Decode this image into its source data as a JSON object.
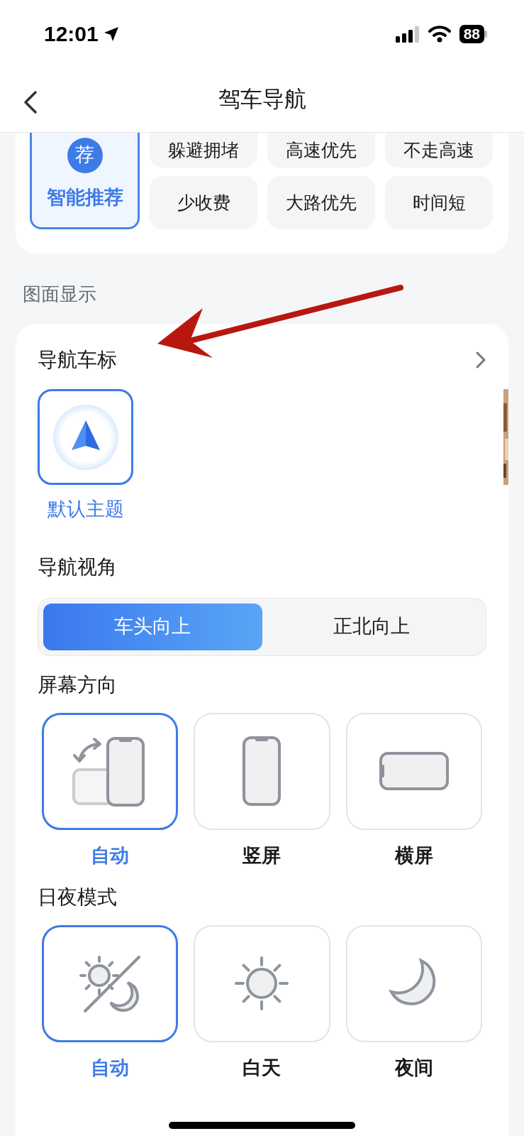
{
  "status_bar": {
    "time": "12:01",
    "battery": "88"
  },
  "header": {
    "title": "驾车导航"
  },
  "route_preferences": {
    "featured": {
      "badge": "荐",
      "label": "智能推荐",
      "selected": true
    },
    "options": [
      {
        "label": "躲避拥堵",
        "selected": false
      },
      {
        "label": "高速优先",
        "selected": false
      },
      {
        "label": "不走高速",
        "selected": false
      },
      {
        "label": "少收费",
        "selected": false
      },
      {
        "label": "大路优先",
        "selected": false
      },
      {
        "label": "时间短",
        "selected": false
      }
    ]
  },
  "section_title": "图面显示",
  "car_icon": {
    "title": "导航车标",
    "themes": [
      {
        "kind": "default",
        "label": "默认主题",
        "selected": true
      },
      {
        "kind": "picture",
        "selected": false
      }
    ]
  },
  "view_angle": {
    "title": "导航视角",
    "options": [
      {
        "label": "车头向上",
        "selected": true
      },
      {
        "label": "正北向上",
        "selected": false
      }
    ]
  },
  "orientation": {
    "title": "屏幕方向",
    "options": [
      {
        "kind": "auto",
        "label": "自动",
        "selected": true
      },
      {
        "kind": "portrait",
        "label": "竖屏",
        "selected": false
      },
      {
        "kind": "landscape",
        "label": "横屏",
        "selected": false
      }
    ]
  },
  "day_night": {
    "title": "日夜模式",
    "options": [
      {
        "kind": "auto",
        "label": "自动",
        "selected": true
      },
      {
        "kind": "day",
        "label": "白天",
        "selected": false
      },
      {
        "kind": "night",
        "label": "夜间",
        "selected": false
      }
    ]
  }
}
